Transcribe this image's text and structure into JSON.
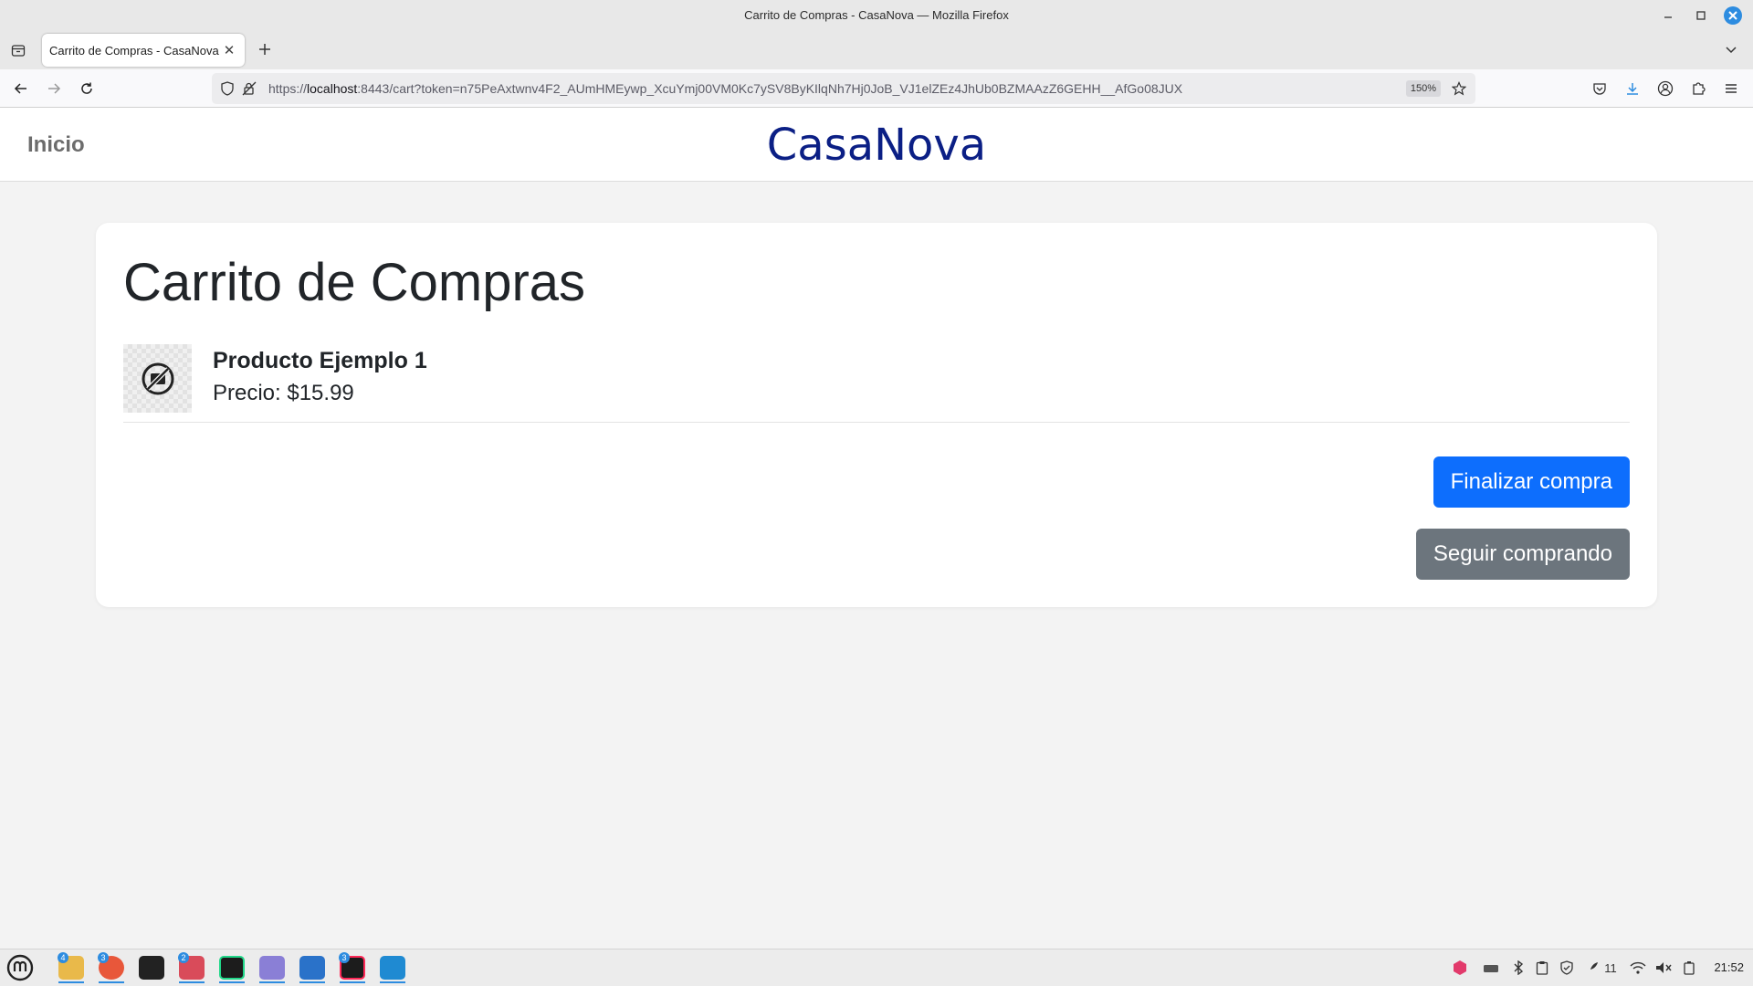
{
  "window": {
    "title": "Carrito de Compras - CasaNova — Mozilla Firefox"
  },
  "tabs": [
    {
      "title": "Carrito de Compras - CasaNova"
    }
  ],
  "urlbar": {
    "url_prefix": "https://",
    "url_host": "localhost",
    "url_rest": ":8443/cart?token=n75PeAxtwnv4F2_AUmHMEywp_XcuYmj00VM0Kc7ySV8ByKIlqNh7Hj0JoB_VJ1elZEz4JhUb0BZMAAzZ6GEHH__AfGo08JUX",
    "zoom": "150%"
  },
  "site": {
    "home_label": "Inicio",
    "brand": "CasaNova"
  },
  "cart": {
    "heading": "Carrito de Compras",
    "items": [
      {
        "name": "Producto Ejemplo 1",
        "price": "Precio: $15.99"
      }
    ],
    "checkout_label": "Finalizar compra",
    "continue_label": "Seguir comprando"
  },
  "taskbar": {
    "apps": [
      {
        "icon": "files-icon",
        "badge": "4"
      },
      {
        "icon": "firefox-icon",
        "badge": "3"
      },
      {
        "icon": "terminal-icon",
        "badge": ""
      },
      {
        "icon": "accessories-icon",
        "badge": "2"
      },
      {
        "icon": "clion-icon",
        "badge": ""
      },
      {
        "icon": "text-editor-icon",
        "badge": ""
      },
      {
        "icon": "writer-icon",
        "badge": ""
      },
      {
        "icon": "intellij-icon",
        "badge": "3"
      },
      {
        "icon": "vscode-icon",
        "badge": ""
      }
    ],
    "notification_count": "11",
    "clock": "21:52"
  }
}
